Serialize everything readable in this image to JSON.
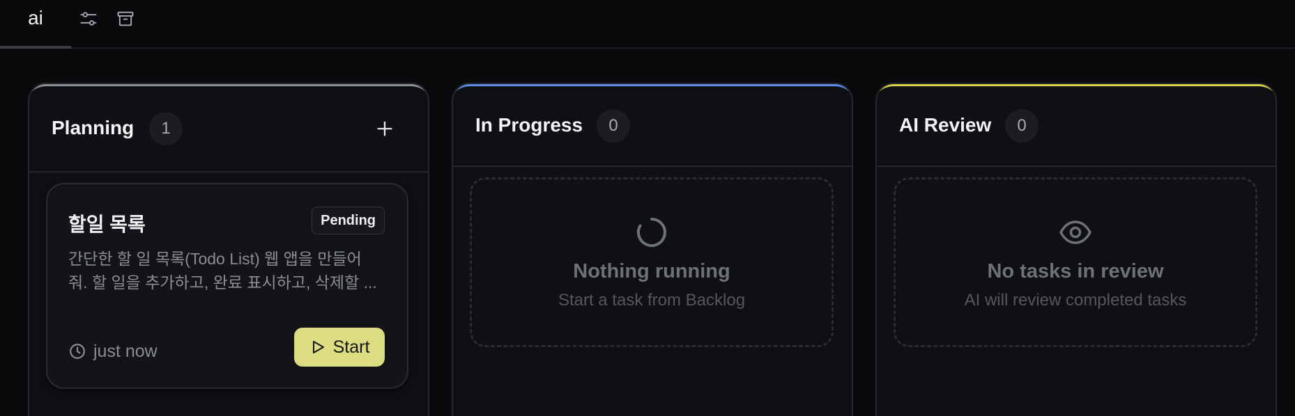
{
  "project_tab": {
    "label": "ai"
  },
  "toolbar": {
    "settings_icon": "sliders-icon",
    "archive_icon": "archive-icon"
  },
  "columns": [
    {
      "title": "Planning",
      "count": "1",
      "accent_color": "#8e9198",
      "add_icon": "plus-icon",
      "cards": [
        {
          "title": "할일 목록",
          "status": "Pending",
          "description_line1": "간단한 할 일 목록(Todo List) 웹 앱을 만들어",
          "description_line2": "줘. 할 일을 추가하고, 완료 표시하고, 삭제할 ...",
          "time": "just now",
          "action_label": "Start",
          "action_color": "#dcdc82"
        }
      ]
    },
    {
      "title": "In Progress",
      "count": "0",
      "accent_color": "#5b8def",
      "empty": {
        "icon": "spinner-icon",
        "title": "Nothing running",
        "subtitle": "Start a task from Backlog"
      }
    },
    {
      "title": "AI Review",
      "count": "0",
      "accent_color": "#d8d44a",
      "empty": {
        "icon": "eye-icon",
        "title": "No tasks in review",
        "subtitle": "AI will review completed tasks"
      }
    }
  ]
}
